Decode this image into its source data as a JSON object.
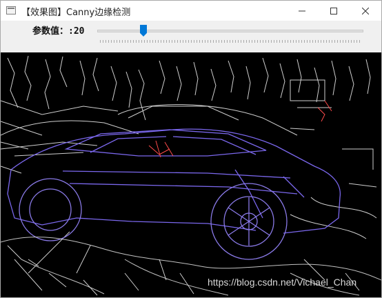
{
  "window": {
    "title": "【效果图】Canny边缘检测",
    "icons": {
      "app": "window-app-icon",
      "minimize": "minimize-icon",
      "maximize": "maximize-icon",
      "close": "close-icon"
    }
  },
  "toolbar": {
    "param_label": "参数值：:20",
    "slider": {
      "value": 20,
      "thumb_color": "#0078d7"
    }
  },
  "image": {
    "subject": "Canny edge-detected sports car",
    "background": "#000000",
    "edge_colors": [
      "#7b68ee",
      "#ffffff",
      "#ff4b4b"
    ]
  },
  "watermark": {
    "text": "https://blog.csdn.net/Vichael_Chan"
  }
}
